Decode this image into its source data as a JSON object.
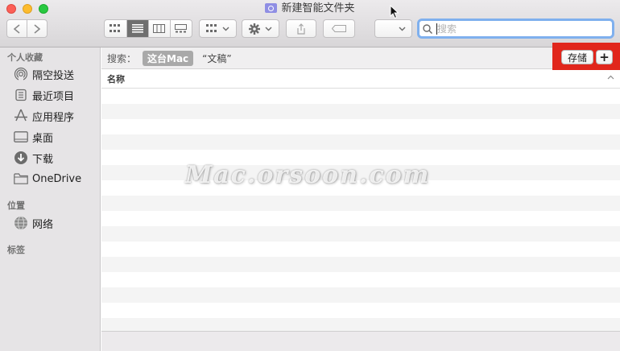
{
  "window": {
    "title": "新建智能文件夹"
  },
  "search": {
    "placeholder": "搜索",
    "value": ""
  },
  "sidebar": {
    "favorites_header": "个人收藏",
    "favorites": [
      {
        "label": "隔空投送",
        "icon": "airdrop-icon"
      },
      {
        "label": "最近项目",
        "icon": "recents-icon"
      },
      {
        "label": "应用程序",
        "icon": "applications-icon"
      },
      {
        "label": "桌面",
        "icon": "desktop-icon"
      },
      {
        "label": "下载",
        "icon": "downloads-icon"
      },
      {
        "label": "OneDrive",
        "icon": "folder-icon"
      }
    ],
    "locations_header": "位置",
    "locations": [
      {
        "label": "网络",
        "icon": "network-icon"
      }
    ],
    "tags_header": "标签"
  },
  "scope": {
    "label": "搜索：",
    "selected": "这台Mac",
    "other": "“文稿”",
    "save_label": "存储",
    "add_label": "+"
  },
  "list": {
    "column_name": "名称",
    "row_count": 16
  },
  "watermark": "Mac.orsoon.com",
  "colors": {
    "highlight": "#e1261c",
    "search_focus": "#7fb0ee",
    "scope_chip": "#a9a9a9"
  }
}
